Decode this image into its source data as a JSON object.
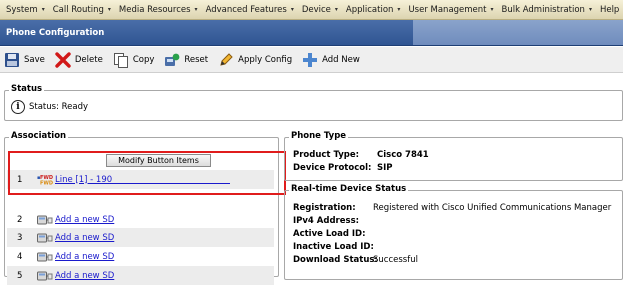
{
  "menubar": {
    "items": [
      {
        "label": "System",
        "id": "system"
      },
      {
        "label": "Call Routing",
        "id": "call-routing"
      },
      {
        "label": "Media Resources",
        "id": "media-resources"
      },
      {
        "label": "Advanced Features",
        "id": "advanced-features"
      },
      {
        "label": "Device",
        "id": "device"
      },
      {
        "label": "Application",
        "id": "application"
      },
      {
        "label": "User Management",
        "id": "user-management"
      },
      {
        "label": "Bulk Administration",
        "id": "bulk-administration"
      },
      {
        "label": "Help",
        "id": "help"
      }
    ],
    "caret": "▾"
  },
  "page": {
    "title": "Phone Configuration"
  },
  "toolbar": {
    "save": "Save",
    "delete": "Delete",
    "copy": "Copy",
    "reset": "Reset",
    "apply": "Apply Config",
    "add_new": "Add New"
  },
  "status": {
    "legend": "Status",
    "text": "Status: Ready",
    "icon": "info-icon"
  },
  "association": {
    "legend": "Association",
    "modify_button": "Modify Button Items",
    "rows": [
      {
        "num": "1",
        "link": "Line [1] - 190",
        "type": "line"
      },
      {
        "num": "2",
        "link": "Add a new SD",
        "type": "sd"
      },
      {
        "num": "3",
        "link": "Add a new SD",
        "type": "sd"
      },
      {
        "num": "4",
        "link": "Add a new SD",
        "type": "sd"
      },
      {
        "num": "5",
        "link": "Add a new SD",
        "type": "sd"
      }
    ]
  },
  "phone_type": {
    "legend": "Phone Type",
    "product_type_label": "Product Type:",
    "product_type": "Cisco 7841",
    "protocol_label": "Device Protocol:",
    "protocol": "SIP"
  },
  "realtime": {
    "legend": "Real-time Device Status",
    "registration_label": "Registration:",
    "registration": "Registered with Cisco Unified Communications Manager",
    "ipv4_label": "IPv4 Address:",
    "active_load_label": "Active Load ID:",
    "inactive_load_label": "Inactive Load ID:",
    "download_label": "Download Status:",
    "download": "Successful"
  },
  "colors": {
    "title_bar": "#3a5f9e",
    "highlight_box": "#e01c1c",
    "link": "#1a1acc"
  }
}
